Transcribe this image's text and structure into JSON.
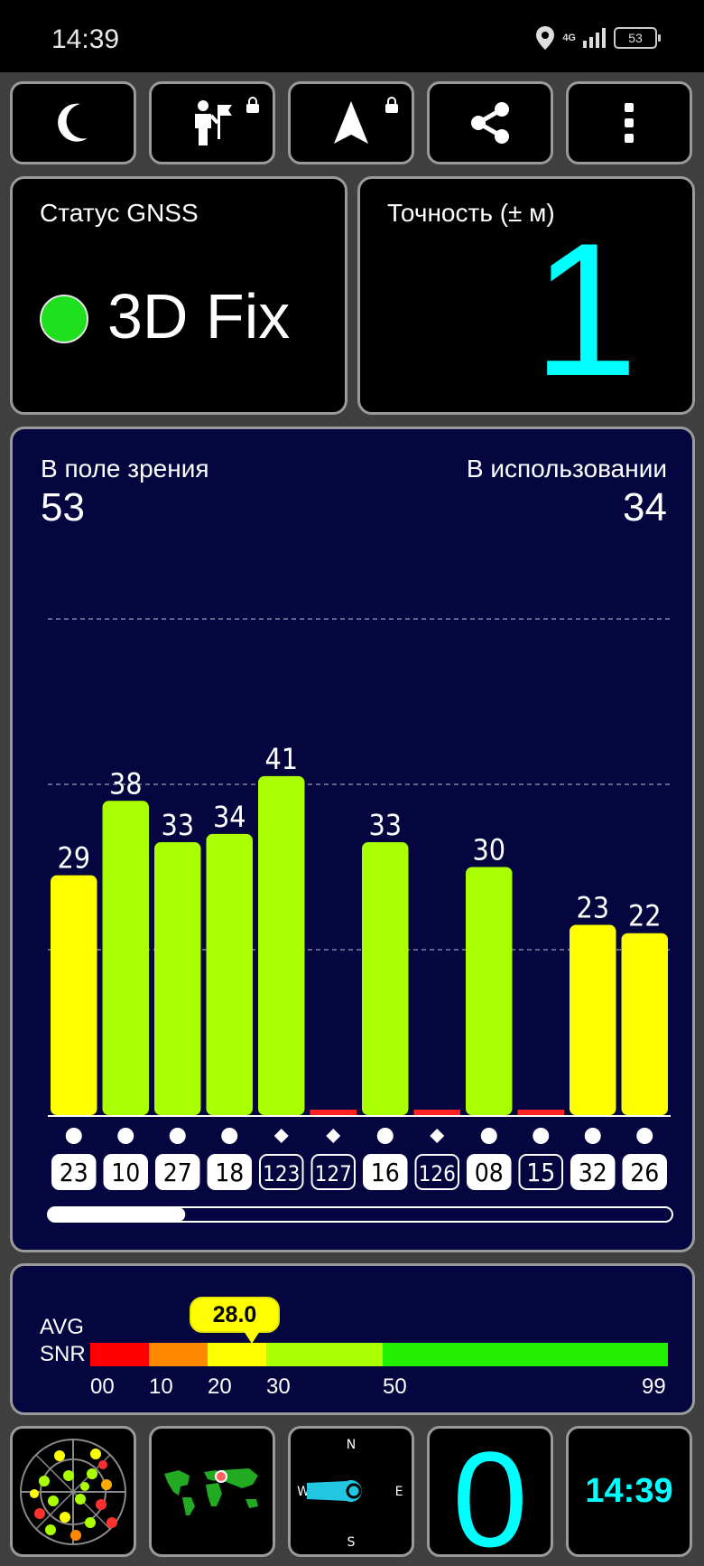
{
  "status_bar": {
    "time": "14:39",
    "network": "4G",
    "battery": "53"
  },
  "toolbar": {
    "buttons": [
      {
        "icon": "moon-icon"
      },
      {
        "icon": "person-flag-icon",
        "locked": true
      },
      {
        "icon": "navigation-arrow-icon",
        "locked": true
      },
      {
        "icon": "share-icon"
      },
      {
        "icon": "more-vert-icon"
      }
    ]
  },
  "gnss": {
    "title": "Статус GNSS",
    "status": "3D Fix",
    "status_color": "#1ee01e"
  },
  "accuracy": {
    "title": "Точность (± м)",
    "value": "1"
  },
  "satellites": {
    "in_view_label": "В поле зрения",
    "in_view": "53",
    "in_use_label": "В использовании",
    "in_use": "34",
    "scroll_position": 0.22
  },
  "chart_data": {
    "type": "bar",
    "categories": [
      "23",
      "10",
      "27",
      "18",
      "123",
      "127",
      "16",
      "126",
      "08",
      "15",
      "32",
      "26"
    ],
    "values": [
      29,
      38,
      33,
      34,
      41,
      0,
      33,
      0,
      30,
      0,
      23,
      22
    ],
    "labels": [
      "29",
      "38",
      "33",
      "34",
      "41",
      "",
      "33",
      "",
      "30",
      "",
      "23",
      "22"
    ],
    "markers": [
      "circle",
      "circle",
      "circle",
      "circle",
      "diamond",
      "diamond",
      "circle",
      "diamond",
      "circle",
      "circle",
      "circle",
      "circle"
    ],
    "in_use": [
      true,
      true,
      true,
      true,
      false,
      false,
      true,
      false,
      true,
      false,
      true,
      true
    ],
    "ylim": [
      0,
      60
    ],
    "gridlines": [
      20,
      40,
      60
    ],
    "colors": {
      "low": "#ff2020",
      "mid": "#ffff00",
      "high": "#aaff00"
    }
  },
  "snr": {
    "label_avg": "AVG",
    "label_snr": "SNR",
    "avg_value": "28.0",
    "ticks": [
      "00",
      "10",
      "20",
      "30",
      "50",
      "99"
    ],
    "scale_colors": [
      "#ff0000",
      "#ff8800",
      "#ffff00",
      "#aaff00",
      "#22ee00"
    ]
  },
  "bottom": {
    "compass": {
      "n": "N",
      "e": "E",
      "s": "S",
      "w": "W"
    },
    "count": "0",
    "clock": "14:39"
  }
}
